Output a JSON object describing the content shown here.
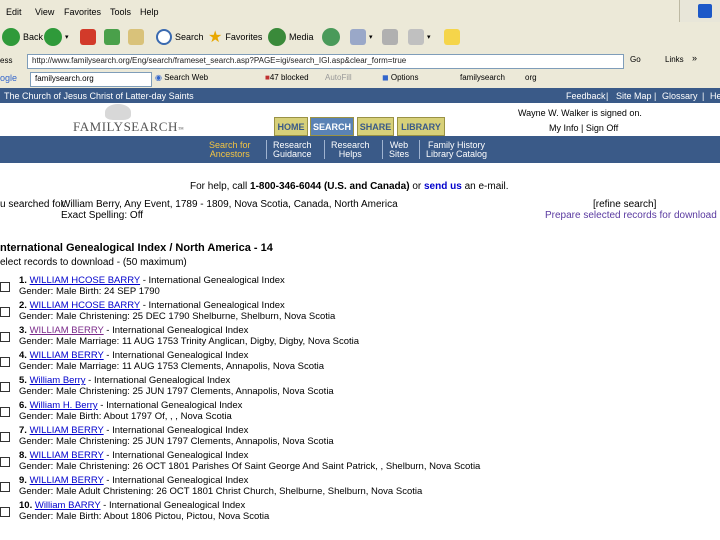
{
  "browser": {
    "menu": [
      "Edit",
      "View",
      "Favorites",
      "Tools",
      "Help"
    ],
    "toolbar": {
      "back": "Back",
      "search": "Search",
      "favorites": "Favorites",
      "media": "Media"
    },
    "address": {
      "label": "ess",
      "url": "http://www.familysearch.org/Eng/search/frameset_search.asp?PAGE=igi/search_IGI.asp&clear_form=true",
      "go": "Go",
      "links": "Links"
    },
    "google": {
      "label": "ogle",
      "search_value": "familysearch.org",
      "search_web": "Search Web",
      "blocked": "47 blocked",
      "autofill": "AutoFill",
      "options": "Options",
      "term1": "familysearch",
      "term2": "org"
    }
  },
  "site": {
    "top_left": "The Church of Jesus Christ of Latter-day Saints",
    "top_links": [
      "Feedback",
      "Site Map",
      "Glossary",
      "He"
    ],
    "signed_in": "Wayne W. Walker is signed on.",
    "my_info": "My Info",
    "sign_off": "Sign Off",
    "logo": "FAMILYSEARCH",
    "tabs": [
      "HOME",
      "SEARCH",
      "SHARE",
      "LIBRARY"
    ],
    "nav": [
      {
        "l1": "Search for",
        "l2": "Ancestors"
      },
      {
        "l1": "Research",
        "l2": "Guidance"
      },
      {
        "l1": "Research",
        "l2": "Helps"
      },
      {
        "l1": "Web",
        "l2": "Sites"
      },
      {
        "l1": "Family History",
        "l2": "Library Catalog"
      }
    ]
  },
  "page": {
    "help_pre": "For help, call ",
    "help_phone": "1-800-346-6044 (U.S. and Canada)",
    "help_mid": " or ",
    "help_link": "send us",
    "help_post": " an e-mail.",
    "searched_label": "u searched for:",
    "searched_value": "William Berry, Any Event, 1789 - 1809, Nova Scotia, Canada, North America",
    "exact": "Exact Spelling: Off",
    "refine": "[refine search]",
    "prepare": "Prepare selected records for download",
    "heading": "nternational Genealogical Index / North America - 14",
    "select_note": "elect records to download - (50 maximum)"
  },
  "records": [
    {
      "num": "1.",
      "name": "WILLIAM HCOSE BARRY",
      "src": " - International Genealogical Index",
      "detail": "Gender: Male Birth: 24 SEP 1790"
    },
    {
      "num": "2.",
      "name": "WILLIAM HCOSE BARRY",
      "src": " - International Genealogical Index",
      "detail": "Gender: Male Christening: 25 DEC 1790 Shelburne, Shelburn, Nova Scotia"
    },
    {
      "num": "3.",
      "name": "WILLIAM BERRY",
      "src": " - International Genealogical Index",
      "detail": "Gender: Male Marriage: 11 AUG 1753 Trinity Anglican, Digby, Digby, Nova Scotia"
    },
    {
      "num": "4.",
      "name": "WILLIAM BERRY",
      "src": " - International Genealogical Index",
      "detail": "Gender: Male Marriage: 11 AUG 1753 Clements, Annapolis, Nova Scotia"
    },
    {
      "num": "5.",
      "name": "William Berry",
      "src": " - International Genealogical Index",
      "detail": "Gender: Male Christening: 25 JUN 1797 Clements, Annapolis, Nova Scotia"
    },
    {
      "num": "6.",
      "name": "William H. Berry",
      "src": " - International Genealogical Index",
      "detail": "Gender: Male Birth: About 1797 Of, , , Nova Scotia"
    },
    {
      "num": "7.",
      "name": "WILLIAM BERRY",
      "src": " - International Genealogical Index",
      "detail": "Gender: Male Christening: 25 JUN 1797 Clements, Annapolis, Nova Scotia"
    },
    {
      "num": "8.",
      "name": "WILLIAM BERRY",
      "src": " - International Genealogical Index",
      "detail": "Gender: Male Christening: 26 OCT 1801 Parishes Of Saint George And Saint Patrick, , Shelburn, Nova Scotia"
    },
    {
      "num": "9.",
      "name": "WILLIAM BERRY",
      "src": " - International Genealogical Index",
      "detail": "Gender: Male Adult Christening: 26 OCT 1801 Christ Church, Shelburne, Shelburn, Nova Scotia"
    },
    {
      "num": "10.",
      "name": "William BARRY",
      "src": " - International Genealogical Index",
      "detail": "Gender: Male Birth: About 1806 Pictou, Pictou, Nova Scotia"
    }
  ]
}
